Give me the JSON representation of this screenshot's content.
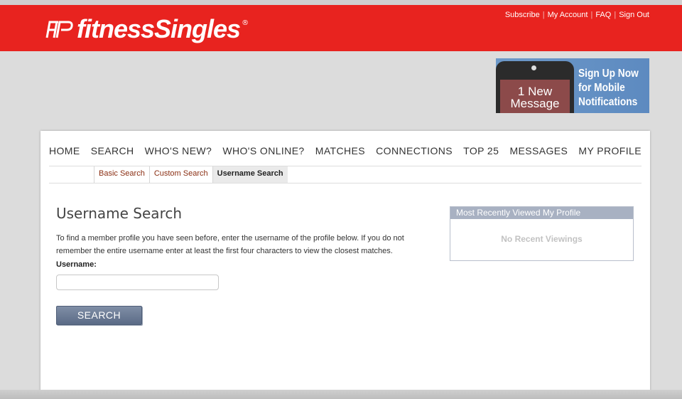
{
  "header": {
    "brand": "fitnessSingles",
    "brand_reg": "®",
    "links": [
      "Subscribe",
      "My Account",
      "FAQ",
      "Sign Out"
    ],
    "brand_color": "#e8231f"
  },
  "banner": {
    "phone_line1": "1 New",
    "phone_line2": "Message",
    "text_line1": "Sign Up Now",
    "text_line2": "for Mobile",
    "text_line3": "Notifications"
  },
  "nav": {
    "items": [
      "HOME",
      "SEARCH",
      "WHO'S NEW?",
      "WHO'S ONLINE?",
      "MATCHES",
      "CONNECTIONS",
      "TOP 25",
      "MESSAGES",
      "MY PROFILE"
    ]
  },
  "subnav": {
    "items": [
      "Basic Search",
      "Custom Search",
      "Username Search"
    ],
    "active": "Username Search"
  },
  "main": {
    "title": "Username Search",
    "description": "To find a member profile you have seen before, enter the username of the profile below. If you do not remember the entire username enter at least the first four characters to view the closest matches.",
    "username_label": "Username:",
    "username_value": "",
    "search_button": "SEARCH"
  },
  "sidebar": {
    "recent_title": "Most Recently Viewed My Profile",
    "recent_empty": "No Recent Viewings"
  }
}
